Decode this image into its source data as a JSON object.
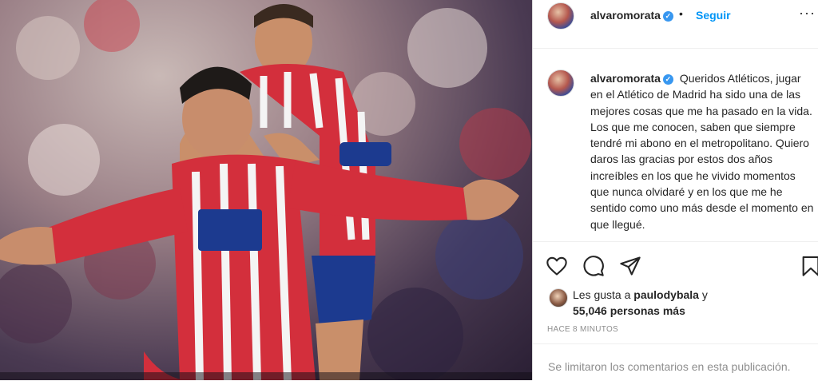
{
  "post": {
    "image_alt": "Two football players in red and white striped jerseys celebrating"
  },
  "header": {
    "username": "alvaromorata",
    "separator": "•",
    "follow_label": "Seguir",
    "more_label": "···"
  },
  "caption": {
    "username": "alvaromorata",
    "text": "Queridos Atléticos, jugar en el Atlético de Madrid ha sido una de las mejores cosas que me ha pasado en la vida. Los que me conocen, saben que siempre tendré mi abono en el metropolitano. Quiero daros las gracias por estos dos años increíbles en los que he vivido momentos que nunca olvidaré y en los que me he sentido como uno más desde el momento en que llegué."
  },
  "likes": {
    "prefix": "Les gusta a",
    "user": "paulodybala",
    "suffix": "y",
    "count_text": "55,046 personas más"
  },
  "timestamp": "HACE 8 MINUTOS",
  "comments_disabled": "Se limitaron los comentarios en esta publicación.",
  "icons": [
    "heart-icon",
    "comment-icon",
    "share-icon",
    "bookmark-icon",
    "verified-icon",
    "more-icon"
  ],
  "colors": {
    "link_blue": "#0095f6",
    "verified_blue": "#3897f0",
    "muted_gray": "#8e8e8e",
    "text": "#262626"
  }
}
